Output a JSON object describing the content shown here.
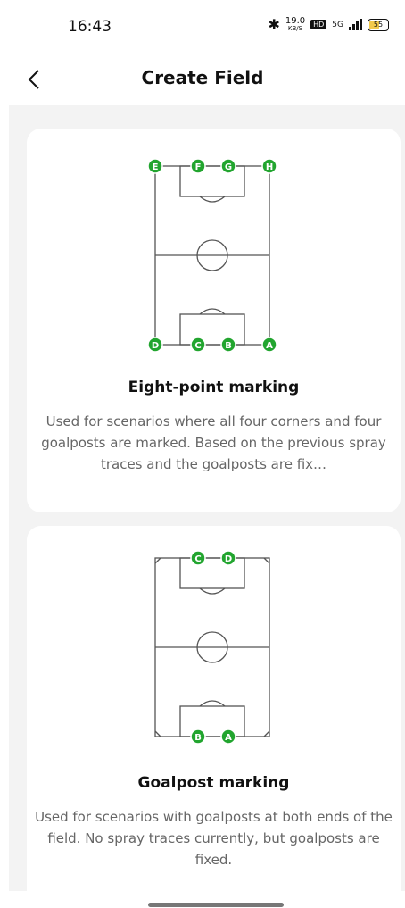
{
  "status_bar": {
    "time": "16:43",
    "bluetooth_icon": "bluetooth-icon",
    "speed_value": "19.0",
    "speed_unit": "KB/S",
    "hd_label": "HD",
    "network_label": "5G",
    "battery": "55"
  },
  "header": {
    "back_icon": "chevron-left-icon",
    "title": "Create Field"
  },
  "cards": [
    {
      "title": "Eight-point marking",
      "description": "Used for scenarios where all four corners and four goalposts are marked. Based on the previous spray traces and the goalposts are fix…",
      "points": [
        "E",
        "F",
        "G",
        "H",
        "D",
        "C",
        "B",
        "A"
      ]
    },
    {
      "title": "Goalpost marking",
      "description": "Used for scenarios with goalposts at both ends of the field. No spray traces currently, but goalposts are fixed.",
      "points": [
        "C",
        "D",
        "B",
        "A"
      ]
    }
  ],
  "colors": {
    "marker": "#22a52f",
    "line": "#555555",
    "background": "#f3f3f3"
  }
}
